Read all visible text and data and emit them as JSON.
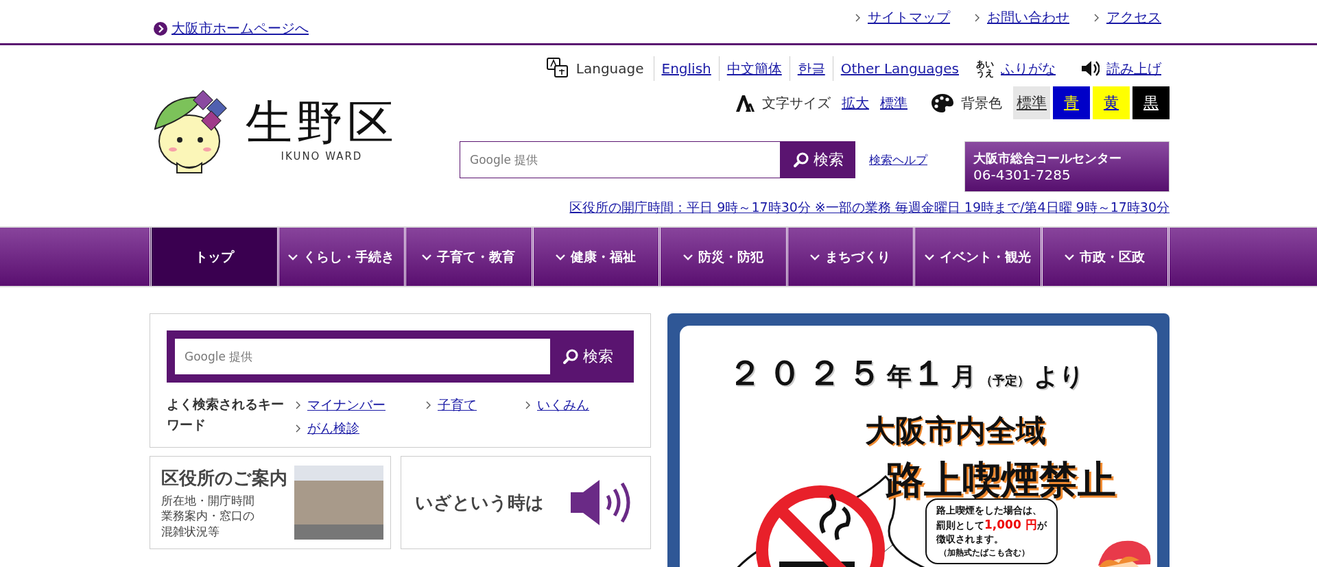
{
  "top_bar": {
    "home_link": "大阪市ホームページへ",
    "links": [
      "サイトマップ",
      "お問い合わせ",
      "アクセス"
    ]
  },
  "logo": {
    "title": "生野区",
    "subtitle": "IKUNO WARD"
  },
  "language": {
    "label": "Language",
    "options": [
      "English",
      "中文簡体",
      "한글",
      "Other Languages"
    ]
  },
  "furigana": {
    "icon_lines": [
      "あい",
      "うえ"
    ],
    "label": "ふりがな"
  },
  "read_aloud": {
    "label": "読み上げ"
  },
  "font_size": {
    "label": "文字サイズ",
    "options": [
      "拡大",
      "標準"
    ]
  },
  "background": {
    "label": "背景色",
    "options": [
      {
        "label": "標準",
        "kind": "standard"
      },
      {
        "label": "青",
        "kind": "blue"
      },
      {
        "label": "黄",
        "kind": "yellow"
      },
      {
        "label": "黒",
        "kind": "black"
      }
    ]
  },
  "search": {
    "placeholder": "Google 提供",
    "button": "検索",
    "help": "検索ヘルプ"
  },
  "call_center": {
    "name": "大阪市総合コールセンター",
    "phone": "06-4301-7285"
  },
  "hours": "区役所の開庁時間：平日 9時～17時30分 ※一部の業務 毎週金曜日 19時まで/第4日曜 9時～17時30分",
  "nav": [
    {
      "label": "トップ",
      "selected": true,
      "has_menu": false
    },
    {
      "label": "くらし・手続き",
      "selected": false,
      "has_menu": true
    },
    {
      "label": "子育て・教育",
      "selected": false,
      "has_menu": true
    },
    {
      "label": "健康・福祉",
      "selected": false,
      "has_menu": true
    },
    {
      "label": "防災・防犯",
      "selected": false,
      "has_menu": true
    },
    {
      "label": "まちづくり",
      "selected": false,
      "has_menu": true
    },
    {
      "label": "イベント・観光",
      "selected": false,
      "has_menu": true
    },
    {
      "label": "市政・区政",
      "selected": false,
      "has_menu": true
    }
  ],
  "site_search": {
    "placeholder": "Google 提供",
    "button": "検索",
    "keywords_label": "よく検索されるキーワード",
    "keywords": [
      "マイナンバー",
      "子育て",
      "いくみん",
      "がん検診"
    ]
  },
  "cards": [
    {
      "kind": "office",
      "title": "区役所のご案内",
      "lines": [
        "所在地・開庁時間",
        "業務案内・窓口の",
        "混雑状況等"
      ]
    },
    {
      "kind": "emergency",
      "title": "いざという時は"
    }
  ],
  "banner": {
    "date_parts": [
      "２０２５",
      "年",
      "１",
      "月",
      "（予定）",
      "より"
    ],
    "area": "大阪市内全域",
    "headline": "路上喫煙禁止",
    "bubble_start": "路上喫煙をした場合は、",
    "bubble_mid": "罰則として",
    "fine": "1,000 円",
    "bubble_end": "が",
    "bubble_last": "徴収されます。",
    "bubble_note": "（加熱式たばこも含む）"
  }
}
